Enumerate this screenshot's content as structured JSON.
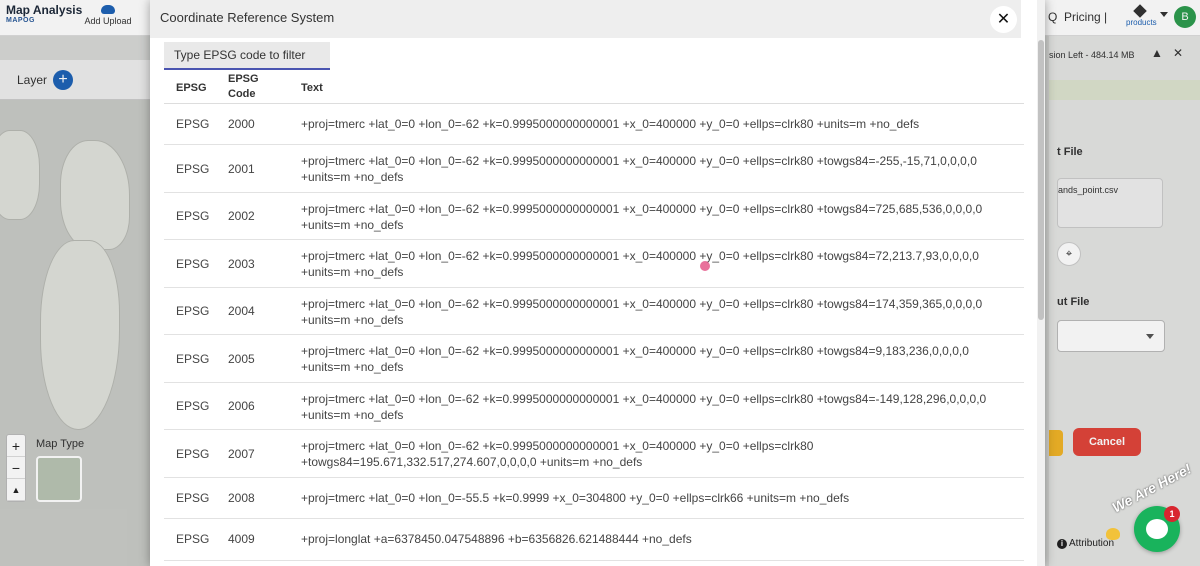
{
  "app": {
    "brand_title": "Map Analysis",
    "brand_sub": "MAPOG",
    "add_upload": "Add Upload",
    "search_q": "Q",
    "pricing": "Pricing |",
    "products": "products",
    "avatar_initial": "B"
  },
  "left_panel": {
    "layer_label": "Layer",
    "layer_add": "+",
    "map_type_label": "Map Type",
    "zoom_in": "+",
    "zoom_out": "−",
    "north": "▲"
  },
  "right_panel": {
    "session_left": "sion Left - 484.14 MB",
    "chevron_up": "▲",
    "close": "✕",
    "input_title": "t File",
    "file_name": "ands_point.csv",
    "scan_icon": "⌖",
    "output_title": "ut File",
    "cancel": "Cancel",
    "attribution": "Attribution",
    "attribution_icon": "i"
  },
  "dialog": {
    "title": "Coordinate Reference System",
    "close": "✕",
    "filter_placeholder": "Type EPSG code to filter",
    "columns": {
      "epsg": "EPSG",
      "code": "EPSG Code",
      "text": "Text"
    },
    "rows": [
      {
        "epsg": "EPSG",
        "code": "2000",
        "text": "+proj=tmerc +lat_0=0 +lon_0=-62 +k=0.9995000000000001 +x_0=400000 +y_0=0 +ellps=clrk80 +units=m +no_defs"
      },
      {
        "epsg": "EPSG",
        "code": "2001",
        "text": "+proj=tmerc +lat_0=0 +lon_0=-62 +k=0.9995000000000001 +x_0=400000 +y_0=0 +ellps=clrk80 +towgs84=-255,-15,71,0,0,0,0 +units=m +no_defs"
      },
      {
        "epsg": "EPSG",
        "code": "2002",
        "text": "+proj=tmerc +lat_0=0 +lon_0=-62 +k=0.9995000000000001 +x_0=400000 +y_0=0 +ellps=clrk80 +towgs84=725,685,536,0,0,0,0 +units=m +no_defs"
      },
      {
        "epsg": "EPSG",
        "code": "2003",
        "text": "+proj=tmerc +lat_0=0 +lon_0=-62 +k=0.9995000000000001 +x_0=400000 +y_0=0 +ellps=clrk80 +towgs84=72,213.7,93,0,0,0,0 +units=m +no_defs"
      },
      {
        "epsg": "EPSG",
        "code": "2004",
        "text": "+proj=tmerc +lat_0=0 +lon_0=-62 +k=0.9995000000000001 +x_0=400000 +y_0=0 +ellps=clrk80 +towgs84=174,359,365,0,0,0,0 +units=m +no_defs"
      },
      {
        "epsg": "EPSG",
        "code": "2005",
        "text": "+proj=tmerc +lat_0=0 +lon_0=-62 +k=0.9995000000000001 +x_0=400000 +y_0=0 +ellps=clrk80 +towgs84=9,183,236,0,0,0,0 +units=m +no_defs"
      },
      {
        "epsg": "EPSG",
        "code": "2006",
        "text": "+proj=tmerc +lat_0=0 +lon_0=-62 +k=0.9995000000000001 +x_0=400000 +y_0=0 +ellps=clrk80 +towgs84=-149,128,296,0,0,0,0 +units=m +no_defs"
      },
      {
        "epsg": "EPSG",
        "code": "2007",
        "text": "+proj=tmerc +lat_0=0 +lon_0=-62 +k=0.9995000000000001 +x_0=400000 +y_0=0 +ellps=clrk80 +towgs84=195.671,332.517,274.607,0,0,0,0 +units=m +no_defs"
      },
      {
        "epsg": "EPSG",
        "code": "2008",
        "text": "+proj=tmerc +lat_0=0 +lon_0=-55.5 +k=0.9999 +x_0=304800 +y_0=0 +ellps=clrk66 +units=m +no_defs"
      },
      {
        "epsg": "EPSG",
        "code": "4009",
        "text": "+proj=longlat +a=6378450.047548896 +b=6356826.621488444 +no_defs"
      }
    ]
  },
  "chat": {
    "banner": "We Are Here!",
    "unread_count": "1"
  },
  "colors": {
    "accent": "#1e63b6",
    "cancel": "#e0453a",
    "chat": "#19b35c",
    "filter_underline": "#4a54b0"
  }
}
